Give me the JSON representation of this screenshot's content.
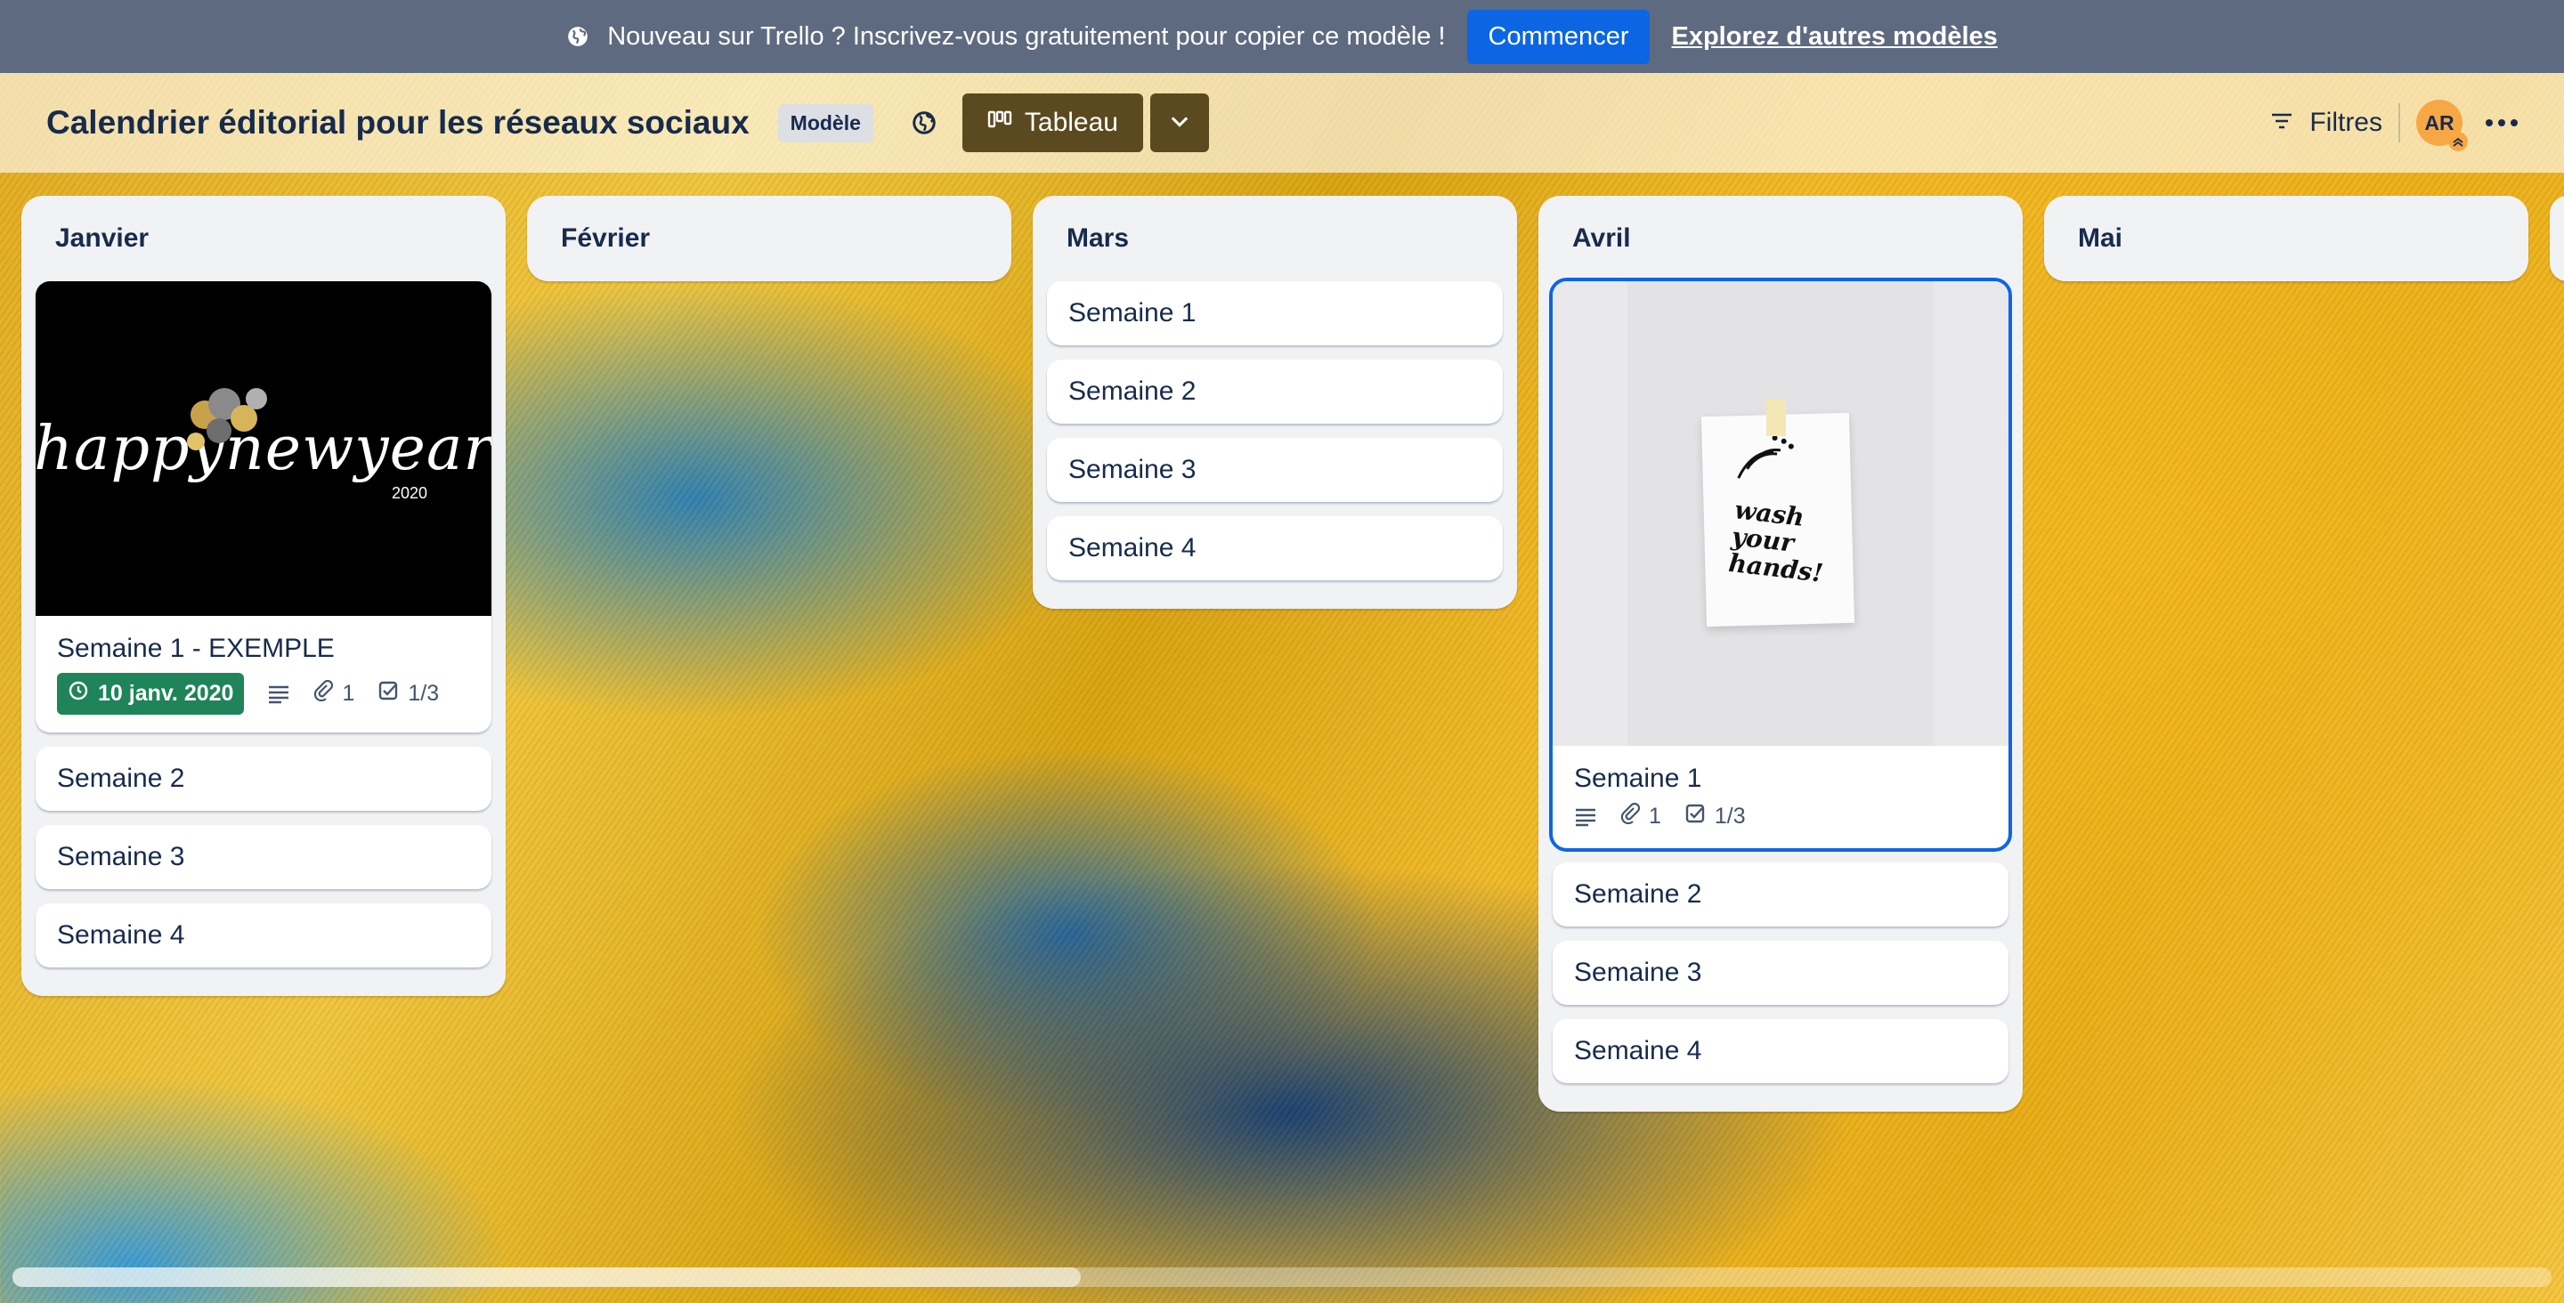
{
  "banner": {
    "message": "Nouveau sur Trello ? Inscrivez-vous gratuitement pour copier ce modèle !",
    "cta": "Commencer",
    "link": "Explorez d'autres modèles"
  },
  "header": {
    "board_title": "Calendrier éditorial pour les réseaux sociaux",
    "badge": "Modèle",
    "view_label": "Tableau",
    "filters_label": "Filtres",
    "avatar_initials": "AR"
  },
  "lists": [
    {
      "title": "Janvier",
      "cards": [
        {
          "title": "Semaine 1 - EXEMPLE",
          "cover_text": "happynewyear",
          "cover_year": "2020",
          "due": "10 janv. 2020",
          "attachments": "1",
          "checklist": "1/3"
        },
        {
          "title": "Semaine 2"
        },
        {
          "title": "Semaine 3"
        },
        {
          "title": "Semaine 4"
        }
      ]
    },
    {
      "title": "Février",
      "cards": []
    },
    {
      "title": "Mars",
      "cards": [
        {
          "title": "Semaine 1"
        },
        {
          "title": "Semaine 2"
        },
        {
          "title": "Semaine 3"
        },
        {
          "title": "Semaine 4"
        }
      ]
    },
    {
      "title": "Avril",
      "cards": [
        {
          "title": "Semaine 1",
          "cover_text": "wash your hands!",
          "attachments": "1",
          "checklist": "1/3"
        },
        {
          "title": "Semaine 2"
        },
        {
          "title": "Semaine 3"
        },
        {
          "title": "Semaine 4"
        }
      ]
    },
    {
      "title": "Mai",
      "cards": []
    }
  ],
  "colors": {
    "banner_bg": "#5e6a80",
    "primary": "#0c66e4",
    "due_green": "#1f845a",
    "list_bg": "#f1f2f4"
  }
}
